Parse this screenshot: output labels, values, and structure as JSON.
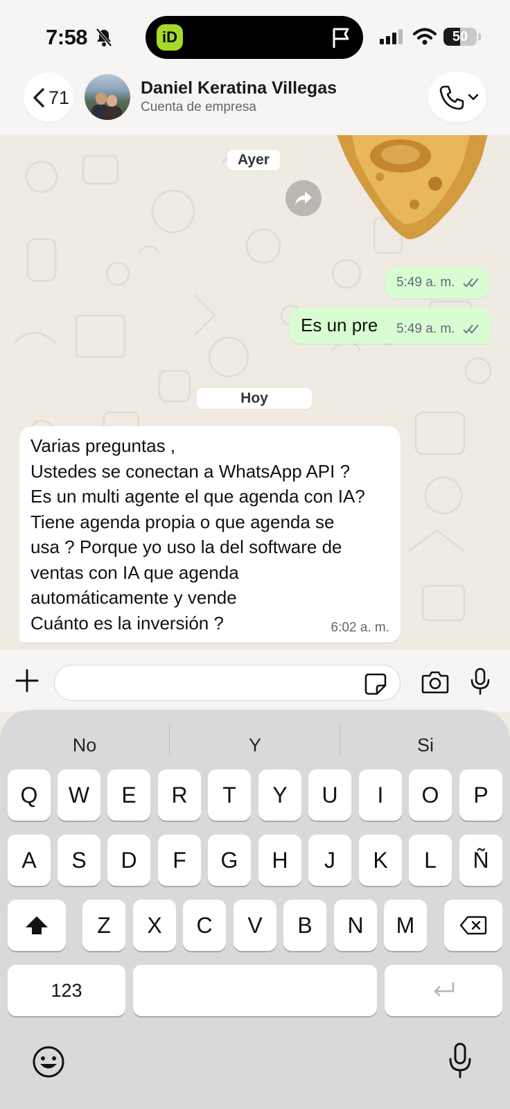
{
  "status_bar": {
    "time": "7:58",
    "island_app_letter": "iD",
    "battery_level": "50",
    "battery_fraction": 0.5
  },
  "header": {
    "back_count": "71",
    "contact_name": "Daniel Keratina Villegas",
    "contact_subtitle": "Cuenta de empresa"
  },
  "chat": {
    "date_yesterday": "Ayer",
    "date_today": "Hoy",
    "outgoing": [
      {
        "text": "",
        "time": "5:49 a. m."
      },
      {
        "text": "Es un pre",
        "time": "5:49 a. m."
      }
    ],
    "incoming": {
      "lines": [
        "Varias preguntas ,",
        "Ustedes se conectan a WhatsApp API ?",
        "Es un multi agente el que agenda con IA?",
        "Tiene agenda propia o que agenda se",
        "usa ? Porque yo uso la del software de",
        "ventas con IA que agenda",
        "automáticamente y vende",
        "Cuánto es la inversión ?"
      ],
      "time": "6:02 a. m."
    }
  },
  "composer": {
    "value": "",
    "icons": [
      "plus-icon",
      "sticker-icon",
      "camera-icon",
      "microphone-icon"
    ]
  },
  "keyboard": {
    "suggestions": [
      "No",
      "Y",
      "Si"
    ],
    "row1": [
      "Q",
      "W",
      "E",
      "R",
      "T",
      "Y",
      "U",
      "I",
      "O",
      "P"
    ],
    "row2": [
      "A",
      "S",
      "D",
      "F",
      "G",
      "H",
      "J",
      "K",
      "L",
      "Ñ"
    ],
    "row3": [
      "Z",
      "X",
      "C",
      "V",
      "B",
      "N",
      "M"
    ],
    "numbers_label": "123",
    "space_label": ""
  },
  "colors": {
    "outgoing_bubble": "#d9fdd3",
    "chat_background": "#efeae2",
    "island_app": "#a6d92a"
  }
}
